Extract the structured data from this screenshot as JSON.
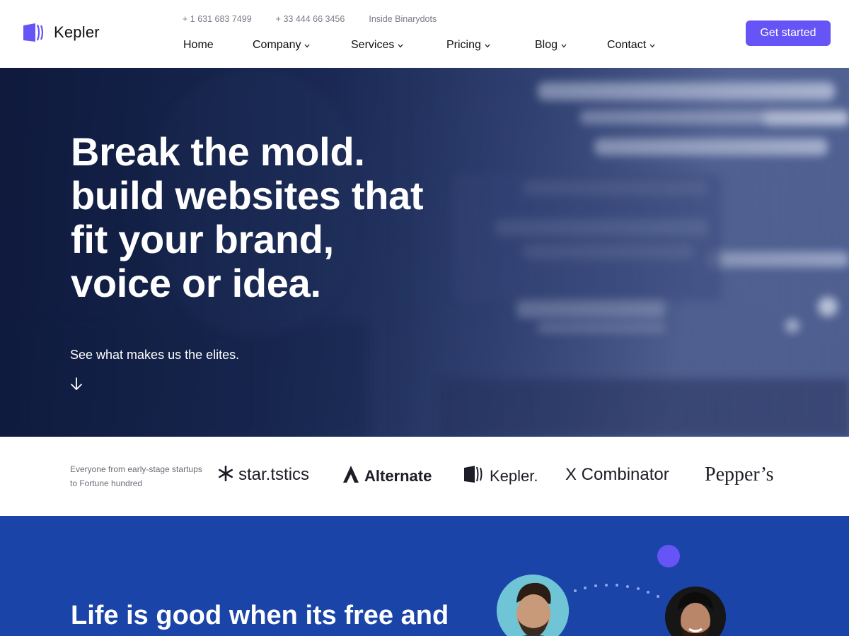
{
  "header": {
    "logo_text": "Kepler",
    "logo_icon": "kepler-book-icon",
    "topline": [
      "+ 1 631 683 7499",
      "+ 33 444 66 3456",
      "Inside Binarydots"
    ],
    "nav": [
      {
        "label": "Home",
        "has_dropdown": false
      },
      {
        "label": "Company",
        "has_dropdown": true
      },
      {
        "label": "Services",
        "has_dropdown": true
      },
      {
        "label": "Pricing",
        "has_dropdown": true
      },
      {
        "label": "Blog",
        "has_dropdown": true
      },
      {
        "label": "Contact",
        "has_dropdown": true
      }
    ],
    "cta_label": "Get started"
  },
  "hero": {
    "title_lines": [
      "Break the mold.",
      "build websites that",
      "fit your brand,",
      "voice or idea."
    ],
    "subtitle": "See what makes us the elites.",
    "arrow_icon": "arrow-down-icon"
  },
  "logos": {
    "caption": "Everyone from early-stage startups to Fortune hundred",
    "brands": [
      {
        "name": "star.tstics",
        "icon": "asterisk-icon"
      },
      {
        "name": "Alternate",
        "icon": "alternate-a-icon"
      },
      {
        "name": "Kepler.",
        "icon": "kepler-book-icon"
      },
      {
        "name": "X Combinator",
        "icon": ""
      },
      {
        "name": "Pepper’s",
        "icon": ""
      }
    ]
  },
  "feature": {
    "title": "Life is good when its free and"
  },
  "colors": {
    "accent": "#6654f6",
    "hero_dark": "#0f1a3d",
    "section_blue": "#1b44a8"
  }
}
